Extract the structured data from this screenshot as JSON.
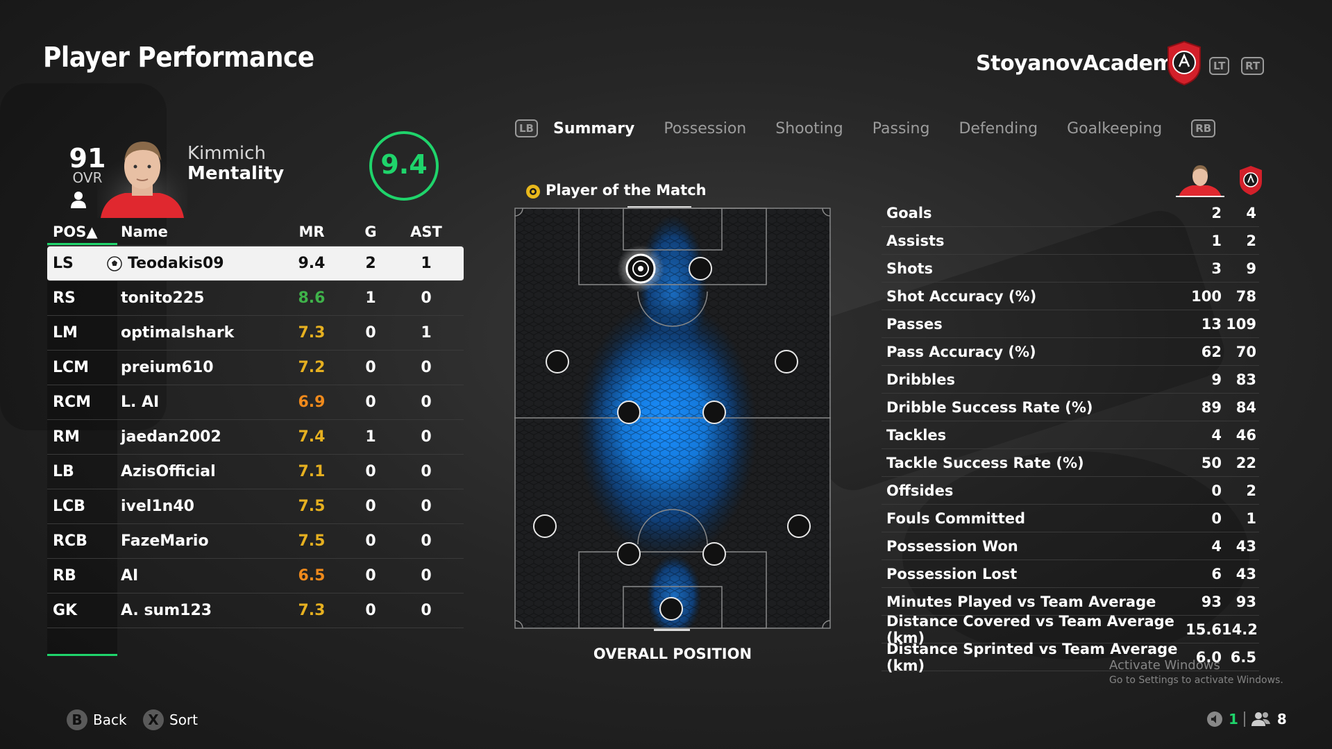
{
  "page": {
    "title": "Player Performance"
  },
  "club": {
    "name": "StoyanovAcademy",
    "lt": "LT",
    "rt": "RT"
  },
  "player": {
    "ovr": "91",
    "ovr_label": "OVR",
    "surname": "Kimmich",
    "role": "Mentality",
    "rating": "9.4"
  },
  "table": {
    "headers": {
      "pos": "POS▲",
      "name": "Name",
      "mr": "MR",
      "g": "G",
      "ast": "AST"
    },
    "rows": [
      {
        "pos": "LS",
        "name": "Teodakis09",
        "mr": "9.4",
        "mr_color": "#111111",
        "g": "2",
        "ast": "1"
      },
      {
        "pos": "RS",
        "name": "tonito225",
        "mr": "8.6",
        "mr_color": "#3fb24a",
        "g": "1",
        "ast": "0"
      },
      {
        "pos": "LM",
        "name": "optimalshark",
        "mr": "7.3",
        "mr_color": "#e6b020",
        "g": "0",
        "ast": "1"
      },
      {
        "pos": "LCM",
        "name": "preium610",
        "mr": "7.2",
        "mr_color": "#e6b020",
        "g": "0",
        "ast": "0"
      },
      {
        "pos": "RCM",
        "name": "L. AI",
        "mr": "6.9",
        "mr_color": "#f08a1c",
        "g": "0",
        "ast": "0"
      },
      {
        "pos": "RM",
        "name": "jaedan2002",
        "mr": "7.4",
        "mr_color": "#e6b020",
        "g": "1",
        "ast": "0"
      },
      {
        "pos": "LB",
        "name": "AzisOfficial",
        "mr": "7.1",
        "mr_color": "#e6b020",
        "g": "0",
        "ast": "0"
      },
      {
        "pos": "LCB",
        "name": "ivel1n40",
        "mr": "7.5",
        "mr_color": "#e6b020",
        "g": "0",
        "ast": "0"
      },
      {
        "pos": "RCB",
        "name": "FazeMario",
        "mr": "7.5",
        "mr_color": "#e6b020",
        "g": "0",
        "ast": "0"
      },
      {
        "pos": "RB",
        "name": "AI",
        "mr": "6.5",
        "mr_color": "#f08a1c",
        "g": "0",
        "ast": "0"
      },
      {
        "pos": "GK",
        "name": "A. sum123",
        "mr": "7.3",
        "mr_color": "#e6b020",
        "g": "0",
        "ast": "0"
      }
    ]
  },
  "tabs": {
    "lb": "LB",
    "rb": "RB",
    "items": [
      "Summary",
      "Possession",
      "Shooting",
      "Passing",
      "Defending",
      "Goalkeeping"
    ],
    "active": "Summary"
  },
  "pitch": {
    "motm_label": "Player of the Match",
    "caption": "OVERALL POSITION"
  },
  "stats": {
    "rows": [
      {
        "label": "Goals",
        "player": "2",
        "team": "4"
      },
      {
        "label": "Assists",
        "player": "1",
        "team": "2"
      },
      {
        "label": "Shots",
        "player": "3",
        "team": "9"
      },
      {
        "label": "Shot Accuracy (%)",
        "player": "100",
        "team": "78"
      },
      {
        "label": "Passes",
        "player": "13",
        "team": "109"
      },
      {
        "label": "Pass Accuracy (%)",
        "player": "62",
        "team": "70"
      },
      {
        "label": "Dribbles",
        "player": "9",
        "team": "83"
      },
      {
        "label": "Dribble Success Rate (%)",
        "player": "89",
        "team": "84"
      },
      {
        "label": "Tackles",
        "player": "4",
        "team": "46"
      },
      {
        "label": "Tackle Success Rate (%)",
        "player": "50",
        "team": "22"
      },
      {
        "label": "Offsides",
        "player": "0",
        "team": "2"
      },
      {
        "label": "Fouls Committed",
        "player": "0",
        "team": "1"
      },
      {
        "label": "Possession Won",
        "player": "4",
        "team": "43"
      },
      {
        "label": "Possession Lost",
        "player": "6",
        "team": "43"
      },
      {
        "label": "Minutes Played vs Team Average",
        "player": "93",
        "team": "93"
      },
      {
        "label": "Distance Covered vs Team Average (km)",
        "player": "15.6",
        "team": "14.2"
      },
      {
        "label": "Distance Sprinted vs Team Average (km)",
        "player": "6.0",
        "team": "6.5"
      }
    ]
  },
  "watermark": {
    "title": "Activate Windows",
    "sub": "Go to Settings to activate Windows."
  },
  "footer": {
    "back_key": "B",
    "back_label": "Back",
    "sort_key": "X",
    "sort_label": "Sort",
    "home_count": "1",
    "players_count": "8"
  },
  "colors": {
    "accent": "#1fd46b",
    "club_red": "#d3202a",
    "heat_blue": "#1a8fff"
  },
  "icons": [
    "person-icon",
    "football-icon",
    "motm-medal-icon",
    "club-crest-icon",
    "speaker-icon",
    "players-icon"
  ]
}
